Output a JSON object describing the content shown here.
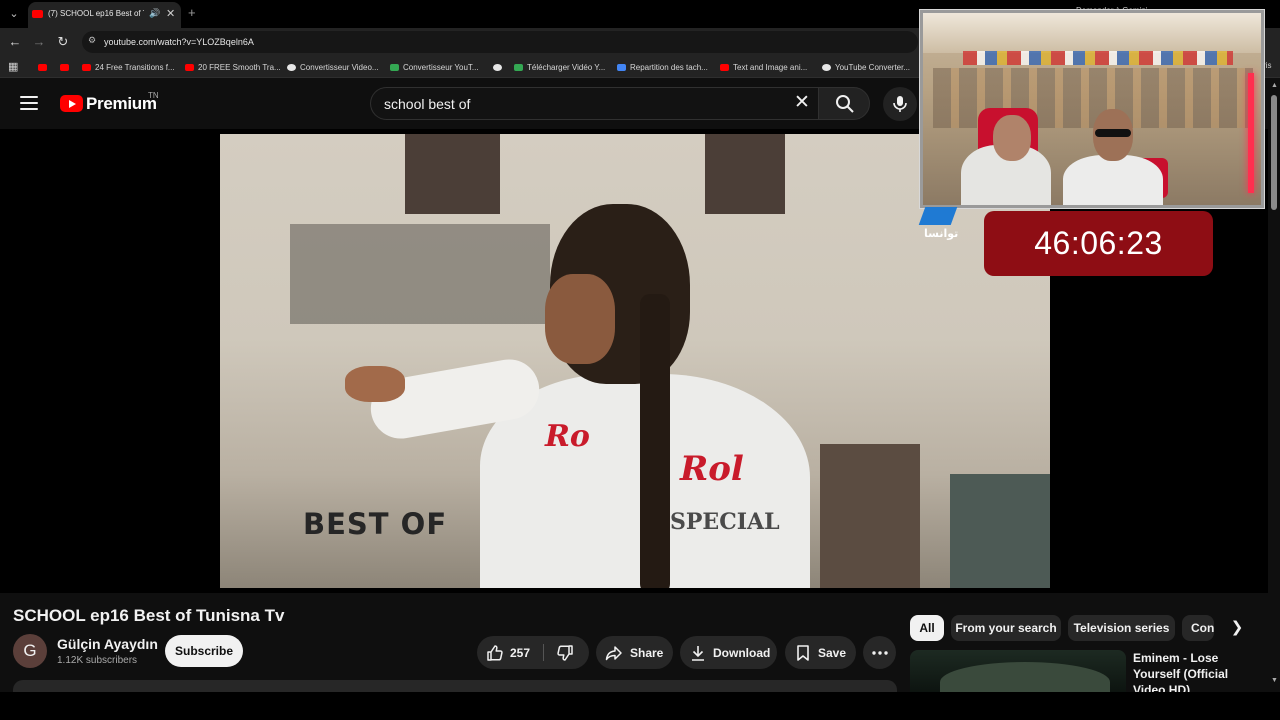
{
  "browser": {
    "tab_title": "(7) SCHOOL ep16 Best of Tu",
    "tab_new_label": "+",
    "gemini_hint": "Demander à Gemini",
    "url": "youtube.com/watch?v=YLOZBqeln6A",
    "bookmarks": [
      {
        "label": "",
        "icon": "youtube-icon"
      },
      {
        "label": "",
        "icon": "youtube-icon"
      },
      {
        "label": "24 Free Transitions f...",
        "icon": "youtube-icon"
      },
      {
        "label": "20 FREE Smooth Tra...",
        "icon": "youtube-icon"
      },
      {
        "label": "Convertisseur Video...",
        "icon": "globe-icon"
      },
      {
        "label": "Convertisseur YouT...",
        "icon": "converter-icon"
      },
      {
        "label": "",
        "icon": "globe-icon"
      },
      {
        "label": "Télécharger Vidéo Y...",
        "icon": "download-icon"
      },
      {
        "label": "Repartition des tach...",
        "icon": "docs-icon"
      },
      {
        "label": "Text and Image ani...",
        "icon": "youtube-icon"
      },
      {
        "label": "YouTube Converter...",
        "icon": "globe-icon"
      }
    ],
    "bookmarks_overflow": "ris"
  },
  "masthead": {
    "brand": "Premium",
    "country_code": "TN",
    "search_value": "school best of"
  },
  "video": {
    "burned_caption": "BEST OF",
    "channel_watermark": "توانسا",
    "shirt_text_1": "Ro",
    "shirt_text_2": "Rol",
    "shirt_text_3": "SPECIAL"
  },
  "overlay": {
    "timer": "46:06:23"
  },
  "watch": {
    "title": "SCHOOL ep16 Best of Tunisna Tv",
    "channel_initial": "G",
    "channel_name": "Gülçin Ayaydın",
    "subscribers": "1.12K subscribers",
    "subscribe_label": "Subscribe",
    "like_count": "257",
    "share_label": "Share",
    "download_label": "Download",
    "save_label": "Save"
  },
  "sidebar": {
    "chips": [
      "All",
      "From your search",
      "Television series",
      "Con"
    ],
    "active_chip": "All",
    "recommendation_title": "Eminem - Lose Yourself (Official Video HD)"
  }
}
